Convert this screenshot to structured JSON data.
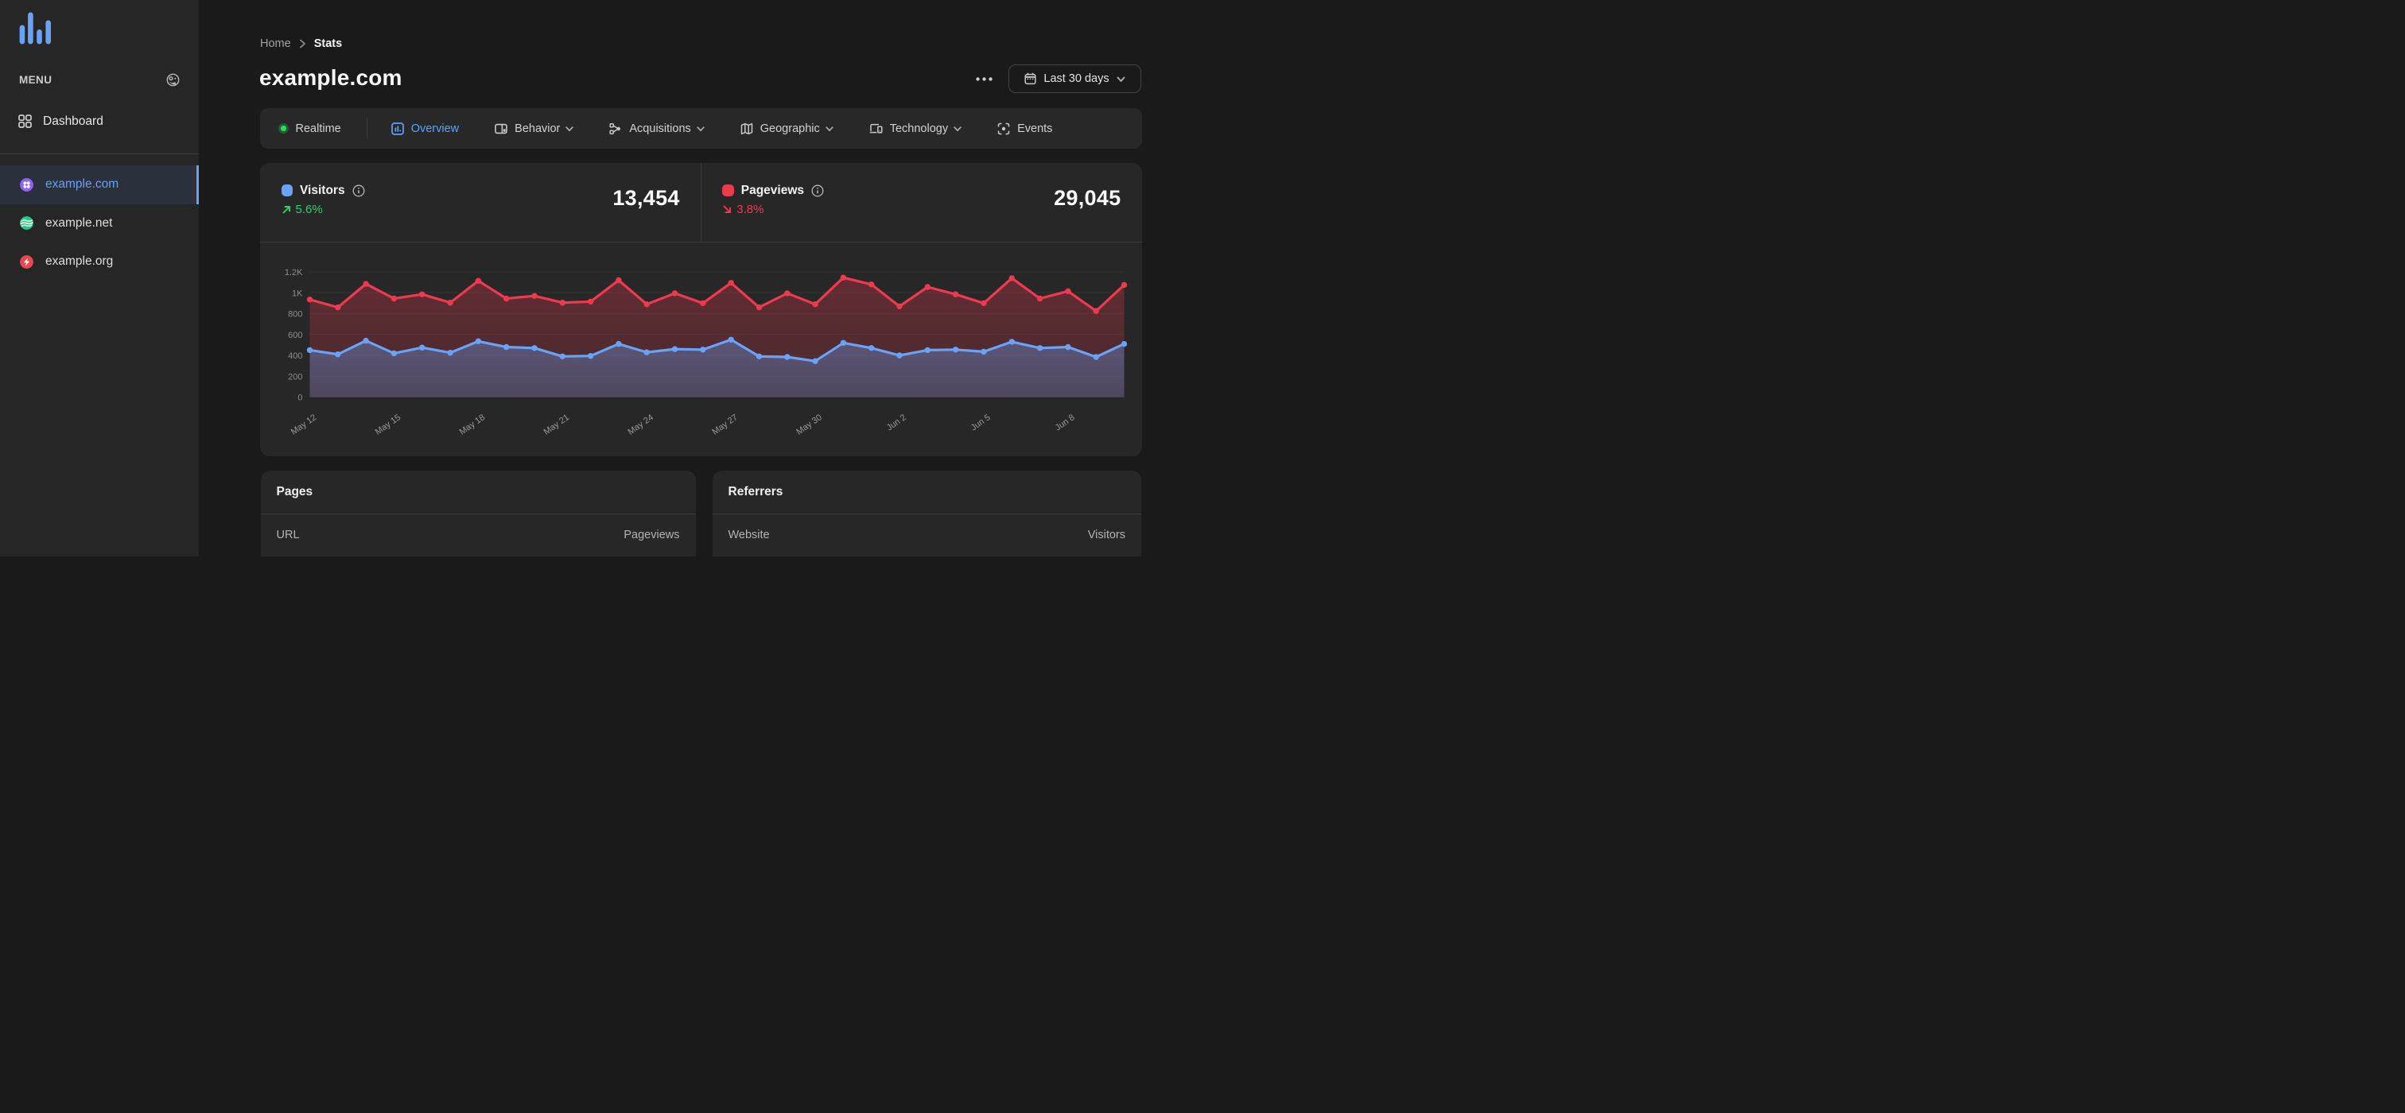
{
  "sidebar": {
    "menu_label": "MENU",
    "dashboard_label": "Dashboard",
    "sites": [
      {
        "name": "example.com",
        "icon": "clover-icon",
        "color": "#8f63f3",
        "selected": true
      },
      {
        "name": "example.net",
        "icon": "waves-icon",
        "color": "#25c87c",
        "selected": false
      },
      {
        "name": "example.org",
        "icon": "bolt-icon",
        "color": "#e8474f",
        "selected": false
      }
    ]
  },
  "header": {
    "breadcrumb": [
      "Home",
      "Stats"
    ],
    "title": "example.com",
    "date_range_label": "Last 30 days"
  },
  "tabs": [
    {
      "label": "Realtime"
    },
    {
      "label": "Overview",
      "active": true
    },
    {
      "label": "Behavior",
      "has_menu": true
    },
    {
      "label": "Acquisitions",
      "has_menu": true
    },
    {
      "label": "Geographic",
      "has_menu": true
    },
    {
      "label": "Technology",
      "has_menu": true
    },
    {
      "label": "Events"
    }
  ],
  "stats": [
    {
      "label": "Visitors",
      "value": "13,454",
      "change": "5.6%",
      "direction": "up",
      "color": "#6aa2f8"
    },
    {
      "label": "Pageviews",
      "value": "29,045",
      "change": "3.8%",
      "direction": "down",
      "color": "#ee3a4e"
    }
  ],
  "panels": [
    {
      "title": "Pages",
      "columns": [
        "URL",
        "Pageviews"
      ]
    },
    {
      "title": "Referrers",
      "columns": [
        "Website",
        "Visitors"
      ]
    }
  ],
  "chart_data": {
    "type": "line",
    "title": "",
    "legend": "none",
    "grid": "horizontal",
    "x": [
      "May 12",
      "May 13",
      "May 14",
      "May 15",
      "May 16",
      "May 17",
      "May 18",
      "May 19",
      "May 20",
      "May 21",
      "May 22",
      "May 23",
      "May 24",
      "May 25",
      "May 26",
      "May 27",
      "May 28",
      "May 29",
      "May 30",
      "May 31",
      "Jun 1",
      "Jun 2",
      "Jun 3",
      "Jun 4",
      "Jun 5",
      "Jun 6",
      "Jun 7",
      "Jun 8",
      "Jun 9",
      "Jun 10"
    ],
    "x_tick_every": 3,
    "ylim": [
      0,
      1200
    ],
    "yticks": [
      {
        "v": 0,
        "label": "0"
      },
      {
        "v": 200,
        "label": "200"
      },
      {
        "v": 400,
        "label": "400"
      },
      {
        "v": 600,
        "label": "600"
      },
      {
        "v": 800,
        "label": "800"
      },
      {
        "v": 1000,
        "label": "1K"
      },
      {
        "v": 1200,
        "label": "1.2K"
      }
    ],
    "series": [
      {
        "name": "Pageviews",
        "color": "#ee3a4e",
        "area_opacity_top": 0.3,
        "area_opacity_bottom": 0.15,
        "values": [
          935,
          860,
          1085,
          945,
          985,
          905,
          1115,
          945,
          970,
          905,
          915,
          1120,
          890,
          995,
          900,
          1095,
          860,
          995,
          890,
          1145,
          1080,
          870,
          1055,
          985,
          900,
          1140,
          945,
          1015,
          825,
          1075
        ]
      },
      {
        "name": "Visitors",
        "color": "#6aa2f8",
        "area_opacity_top": 0.36,
        "area_opacity_bottom": 0.24,
        "values": [
          450,
          410,
          540,
          420,
          475,
          425,
          535,
          480,
          470,
          390,
          395,
          510,
          430,
          460,
          455,
          550,
          390,
          385,
          345,
          520,
          470,
          400,
          450,
          455,
          435,
          530,
          470,
          480,
          385,
          510
        ]
      }
    ]
  }
}
